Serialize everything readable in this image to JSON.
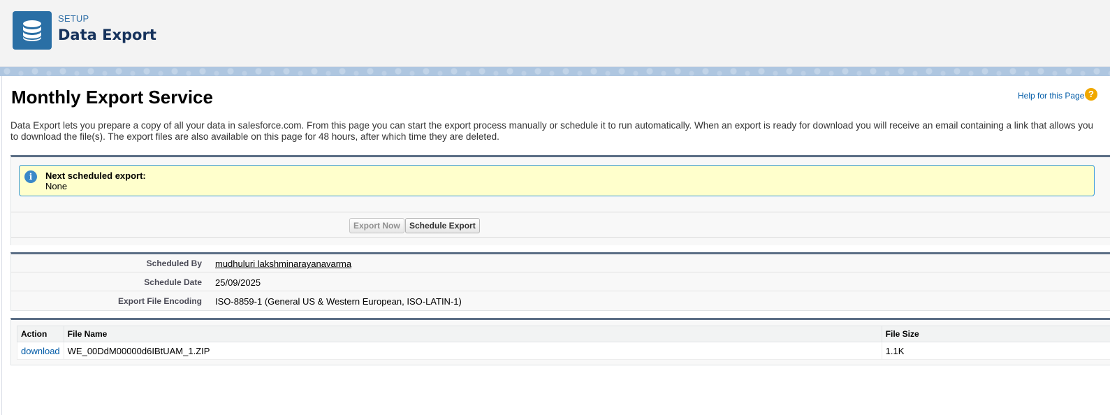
{
  "header": {
    "kicker": "SETUP",
    "title": "Data Export",
    "icon": "database-icon",
    "icon_bg": "#2a6fa5"
  },
  "page": {
    "title": "Monthly Export Service",
    "help_link": "Help for this Page",
    "help_icon": "?",
    "description": "Data Export lets you prepare a copy of all your data in salesforce.com. From this page you can start the export process manually or schedule it to run automatically. When an export is ready for download you will receive an email containing a link that allows you to download the file(s). The export files are also available on this page for 48 hours, after which time they are deleted."
  },
  "info": {
    "icon": "i",
    "label": "Next scheduled export:",
    "value": "None"
  },
  "buttons": {
    "export_now": "Export Now",
    "schedule_export": "Schedule Export"
  },
  "details": [
    {
      "label": "Scheduled By",
      "value": "mudhuluri lakshminarayanavarma",
      "is_link": true
    },
    {
      "label": "Schedule Date",
      "value": "25/09/2025",
      "is_link": false
    },
    {
      "label": "Export File Encoding",
      "value": "ISO-8859-1 (General US & Western European, ISO-LATIN-1)",
      "is_link": false
    }
  ],
  "files": {
    "columns": [
      "Action",
      "File Name",
      "File Size"
    ],
    "rows": [
      {
        "action": "download",
        "file_name": "WE_00DdM00000d6IBtUAM_1.ZIP",
        "file_size": "1.1K"
      }
    ]
  },
  "colors": {
    "link": "#015ba7",
    "section_border": "#5b6e85",
    "info_bg": "#ffffcc",
    "info_border": "#3a9ad9",
    "help_icon": "#f0a800"
  }
}
